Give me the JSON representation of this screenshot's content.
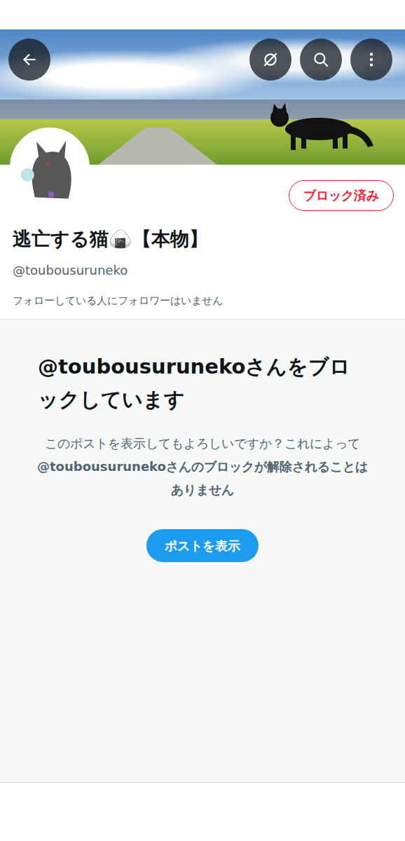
{
  "header": {
    "block_button": {
      "label": "ブロック済み"
    }
  },
  "profile": {
    "name": "逃亡する猫🍙【本物】",
    "handle": "@toubousuruneko",
    "followers_note": "フォローしている人にフォロワーはいません"
  },
  "notice": {
    "title": "@toubousurunekoさんをブロックしています",
    "message_start": "このポストを表示してもよろしいですか？これによって",
    "message_handle": "@toubousuruneko",
    "message_end": "さんのブロックが解除されることはありません",
    "button": "ポストを表示"
  }
}
